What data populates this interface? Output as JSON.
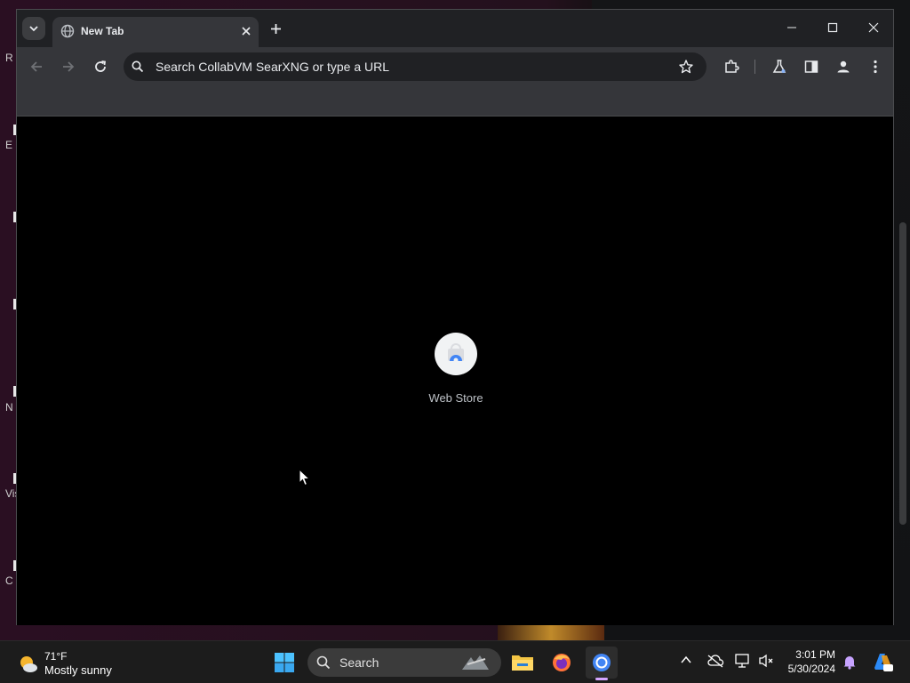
{
  "desktop": {
    "icon_labels": [
      "R",
      "E",
      "N",
      "Vis",
      "C"
    ]
  },
  "browser": {
    "tab": {
      "title": "New Tab"
    },
    "omnibox": {
      "placeholder": "Search CollabVM SearXNG or type a URL"
    },
    "shortcuts": [
      {
        "label": "Web Store"
      }
    ]
  },
  "taskbar": {
    "weather": {
      "temp": "71°F",
      "desc": "Mostly sunny"
    },
    "search_label": "Search",
    "clock": {
      "time": "3:01 PM",
      "date": "5/30/2024"
    }
  },
  "colors": {
    "browser_frame": "#202124",
    "toolbar": "#35363a",
    "content_bg": "#000000",
    "taskbar": "#1c1c1c",
    "accent": "#d4a5ff"
  },
  "icons": {
    "tab_favicon": "globe-icon",
    "back": "arrow-left-icon",
    "forward": "arrow-right-icon",
    "reload": "reload-icon",
    "bookmark": "star-icon",
    "extensions": "puzzle-icon",
    "labs": "flask-icon",
    "side_panel": "side-panel-icon",
    "profile": "person-icon",
    "menu": "kebab-menu-icon"
  }
}
